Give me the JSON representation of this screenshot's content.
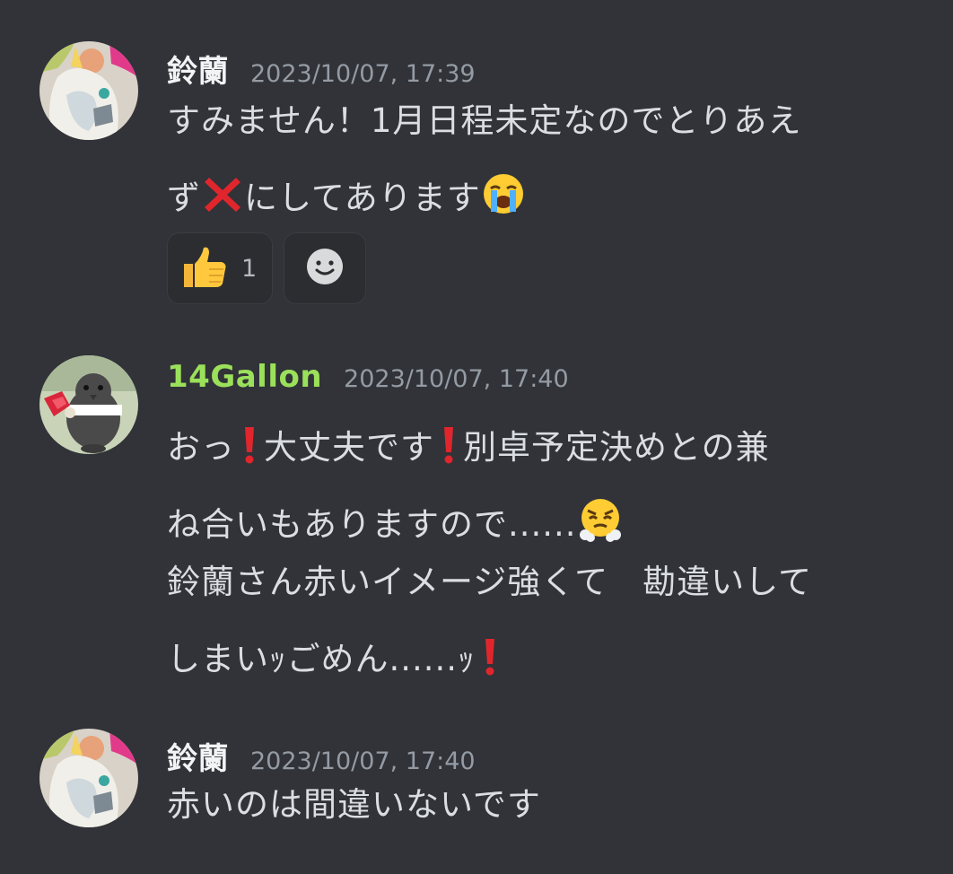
{
  "messages": [
    {
      "username": "鈴蘭",
      "timestamp": "2023/10/07, 17:39",
      "lines": {
        "l1": "すみません！1月日程未定なのでとりあえ",
        "l2a": "ず",
        "l2b": "にしてあります"
      },
      "emoji": [
        "cross-mark",
        "loudly-crying-face"
      ],
      "reactions": {
        "thumbs_up_count": "1",
        "icons": [
          "thumbs-up",
          "add-reaction"
        ]
      }
    },
    {
      "username": "14Gallon",
      "username_color": "#9be05a",
      "timestamp": "2023/10/07, 17:40",
      "lines": {
        "l1a": "おっ",
        "l1b": "大丈夫です",
        "l1c": "別卓予定決めとの兼",
        "l2": "ね合いもありますので......",
        "l3": "鈴蘭さん赤いイメージ強くて　勘違いして",
        "l4": "しまいｯごめん......ｯ"
      },
      "emoji": [
        "red-exclamation-mark",
        "face-with-steam"
      ]
    },
    {
      "username": "鈴蘭",
      "timestamp": "2023/10/07, 17:40",
      "lines": {
        "l1": "赤いのは間違いないです"
      }
    }
  ],
  "colors": {
    "background": "#313338",
    "text": "#dbdee1",
    "timestamp": "#949ba4",
    "reaction_bg": "#2b2d31"
  }
}
